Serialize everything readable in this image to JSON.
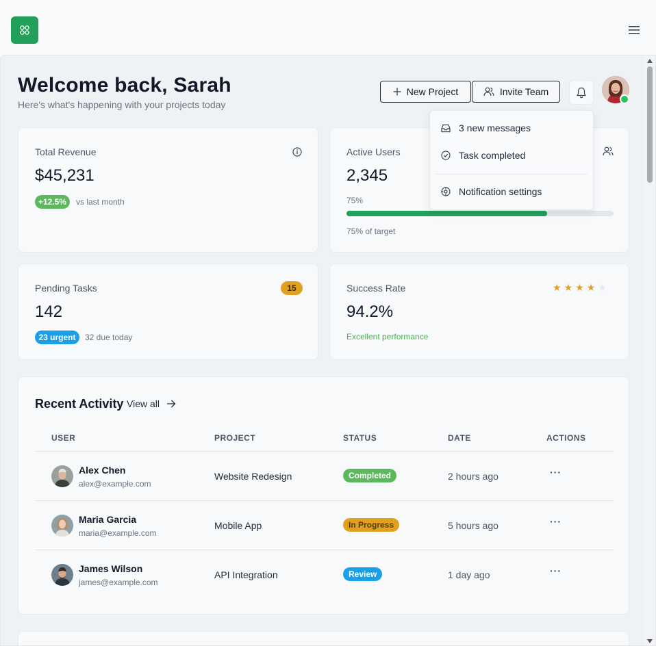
{
  "header": {
    "title": "Welcome back, Sarah",
    "subtitle": "Here's what's happening with your projects today",
    "new_project_label": "New Project",
    "invite_team_label": "Invite Team"
  },
  "notifications": {
    "items": [
      {
        "icon": "inbox-icon",
        "label": "3 new messages"
      },
      {
        "icon": "check-circle-icon",
        "label": "Task completed"
      },
      {
        "icon": "settings-icon",
        "label": "Notification settings"
      }
    ]
  },
  "stats": {
    "revenue": {
      "title": "Total Revenue",
      "value": "$45,231",
      "change": "+12.5%",
      "change_note": "vs last month"
    },
    "users": {
      "title": "Active Users",
      "value": "2,345",
      "percent_label": "75%",
      "progress": 0.75,
      "target_note": "75% of target"
    },
    "tasks": {
      "title": "Pending Tasks",
      "value": "142",
      "count_badge": "15",
      "urgent": "23 urgent",
      "due_note": "32 due today"
    },
    "success": {
      "title": "Success Rate",
      "value": "94.2%",
      "rating": 4,
      "rating_max": 5,
      "note": "Excellent performance"
    }
  },
  "activity": {
    "title": "Recent Activity",
    "view_all": "View all",
    "columns": [
      "USER",
      "PROJECT",
      "STATUS",
      "DATE",
      "ACTIONS"
    ],
    "rows": [
      {
        "name": "Alex Chen",
        "email": "alex@example.com",
        "project": "Website Redesign",
        "status": "Completed",
        "date": "2 hours ago",
        "actions": "···"
      },
      {
        "name": "Maria Garcia",
        "email": "maria@example.com",
        "project": "Mobile App",
        "status": "In Progress",
        "date": "5 hours ago",
        "actions": "···"
      },
      {
        "name": "James Wilson",
        "email": "james@example.com",
        "project": "API Integration",
        "status": "Review",
        "date": "1 day ago",
        "actions": "···"
      }
    ]
  },
  "colors": {
    "brand": "#22a05a",
    "completed": "#5cb85c",
    "in_progress": "#e0a020",
    "review": "#1aa0e8",
    "urgent": "#1aa0e8",
    "star": "#e0a020"
  }
}
